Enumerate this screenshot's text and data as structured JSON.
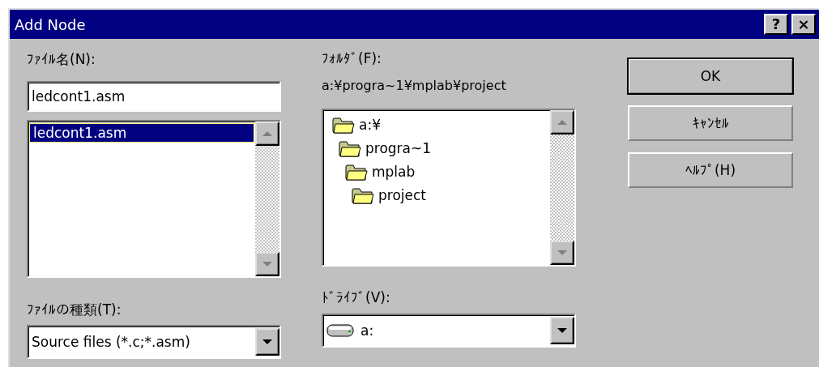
{
  "window": {
    "title": "Add Node",
    "title_buttons": [
      "?",
      "×"
    ]
  },
  "file_name": {
    "label": "ﾌｧｲﾙ名(N):",
    "value": "ledcont1.asm",
    "files": [
      {
        "name": "ledcont1.asm",
        "selected": true
      }
    ]
  },
  "folder": {
    "label": "ﾌｫﾙﾀﾞ(F):",
    "path": "a:¥progra~1¥mplab¥project",
    "tree": [
      {
        "name": "a:¥",
        "children": [
          {
            "name": "progra~1",
            "children": [
              {
                "name": "mplab",
                "children": [
                  {
                    "name": "project"
                  }
                ]
              }
            ]
          }
        ]
      }
    ]
  },
  "file_type": {
    "label": "ﾌｧｲﾙの種類(T):",
    "value": "Source files (*.c;*.asm)"
  },
  "drive": {
    "label": "ﾄﾞﾗｲﾌﾞ(V):",
    "value": "a:"
  },
  "buttons": [
    {
      "label": "OK",
      "default": true
    },
    {
      "label": "ｷｬﾝｾﾙ",
      "default": false
    },
    {
      "label": "ﾍﾙﾌﾟ(H)",
      "default": false
    }
  ]
}
